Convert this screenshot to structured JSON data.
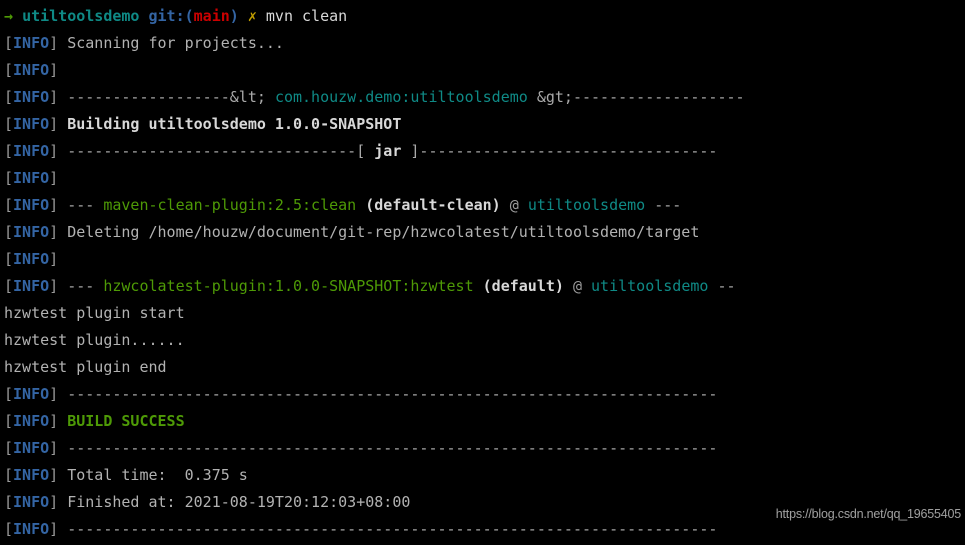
{
  "terminal": {
    "background_color": "#000000",
    "foreground_color": "#b2b2b2",
    "colors": {
      "info_label": "#3465a4",
      "bracket": "#9a9a9a",
      "project_coords": "#0f8a86",
      "plugin_name": "#4e9a06",
      "build_success": "#4e9a06",
      "emphasis": "#d8d8d8",
      "prompt_arrow": "#4e9a06",
      "prompt_dir": "#0f8a86",
      "prompt_git": "#3465a4",
      "prompt_branch": "#cc0000",
      "prompt_dirty": "#c4a000",
      "dashes": "#a9a9a9"
    }
  },
  "prompt": {
    "arrow": "→",
    "cwd": "utiltoolsdemo",
    "git_prefix": "git:(",
    "git_branch": "main",
    "git_suffix": ")",
    "dirty_marker": "✗",
    "command": "mvn clean"
  },
  "info_label": {
    "open_bracket": "[",
    "text": "INFO",
    "close_bracket": "]"
  },
  "log": {
    "scanning": "Scanning for projects...",
    "blank": "",
    "sep_coords_left": "------------------&lt;",
    "project_coords": "com.houzw.demo:utiltoolsdemo",
    "sep_coords_right": "&gt;-------------------",
    "building": "Building utiltoolsdemo 1.0.0-SNAPSHOT",
    "sep_jar_left": "--------------------------------[",
    "jar_packaging": "jar",
    "sep_jar_right": "]---------------------------------",
    "goal_dashes": "---",
    "clean_plugin": "maven-clean-plugin:2.5:clean",
    "clean_execution": "(default-clean)",
    "at_symbol": "@",
    "clean_module": "utiltoolsdemo",
    "clean_trailing_dashes": "---",
    "deleting": "Deleting /home/houzw/document/git-rep/hzwcolatest/utiltoolsdemo/target",
    "hzw_plugin": "hzwcolatest-plugin:1.0.0-SNAPSHOT:hzwtest",
    "hzw_execution": "(default)",
    "hzw_module": "utiltoolsdemo",
    "hzw_trailing_dashes": "--",
    "plugin_start": "hzwtest plugin start",
    "plugin_dots": "hzwtest plugin......",
    "plugin_end": "hzwtest plugin end",
    "sep_full": "------------------------------------------------------------------------",
    "build_result": "BUILD SUCCESS",
    "total_time_label": "Total time:",
    "total_time_value": "0.375 s",
    "finished_label": "Finished at:",
    "finished_value": "2021-08-19T20:12:03+08:00"
  },
  "watermark": {
    "text": "https://blog.csdn.net/qq_19655405"
  }
}
